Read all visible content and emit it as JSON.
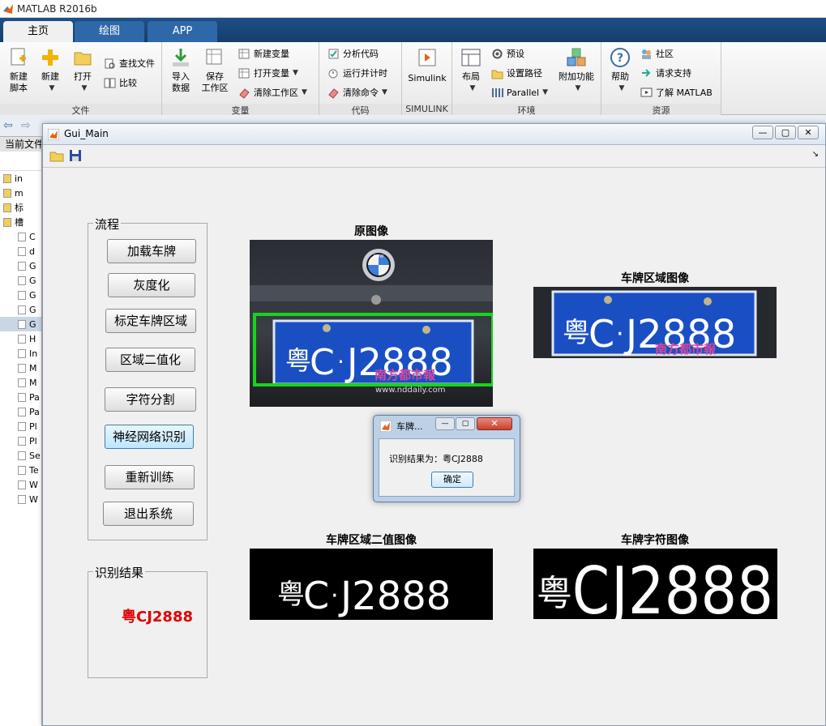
{
  "app": {
    "title": "MATLAB R2016b"
  },
  "tabs": [
    "主页",
    "绘图",
    "APP"
  ],
  "ribbon": {
    "file": {
      "label": "文件",
      "new_script": "新建\n脚本",
      "new": "新建",
      "open": "打开",
      "find_files": "查找文件",
      "compare": "比较"
    },
    "variable": {
      "label": "变量",
      "import": "导入\n数据",
      "save_ws": "保存\n工作区",
      "new_var": "新建变量",
      "open_var": "打开变量",
      "clear_ws": "清除工作区"
    },
    "code": {
      "label": "代码",
      "analyze": "分析代码",
      "run_time": "运行并计时",
      "clear_cmd": "清除命令"
    },
    "simulink": {
      "label": "SIMULINK",
      "btn": "Simulink"
    },
    "env": {
      "label": "环境",
      "layout": "布局",
      "prefs": "预设",
      "set_path": "设置路径",
      "parallel": "Parallel",
      "addons": "附加功能"
    },
    "resources": {
      "label": "资源",
      "help": "帮助",
      "community": "社区",
      "support": "请求支持",
      "learn": "了解 MATLAB"
    }
  },
  "left_pane": {
    "title": "当前文件",
    "rows": [
      "in",
      "m",
      "标",
      "槽",
      "C",
      "d",
      "G",
      "G",
      "G",
      "G",
      "G",
      "H",
      "In",
      "M",
      "M",
      "Pa",
      "Pa",
      "Pl",
      "Pl",
      "Se",
      "Te",
      "W",
      "W"
    ]
  },
  "figure": {
    "title": "Gui_Main",
    "process_panel": {
      "label": "流程",
      "buttons": [
        "加载车牌",
        "灰度化",
        "标定车牌区域",
        "区域二值化",
        "字符分割",
        "神经网络识别",
        "重新训练",
        "退出系统"
      ]
    },
    "result_panel": {
      "label": "识别结果",
      "value": "粤CJ2888"
    },
    "axes_titles": {
      "original": "原图像",
      "plate_region": "车牌区域图像",
      "binary": "车牌区域二值图像",
      "chars": "车牌字符图像"
    },
    "plate_text": {
      "province": "粤",
      "letter": "C",
      "dot": "·",
      "number": "J2888",
      "brand": "BMW",
      "watermark": "南方都市報",
      "url": "www.nddaily.com"
    }
  },
  "dialog": {
    "title": "车牌...",
    "message": "识别结果为：粤CJ2888",
    "ok": "确定"
  },
  "colors": {
    "tab_blue": "#1d4f86",
    "plate_blue": "#1a4fc4",
    "result_red": "#e00000",
    "detect_green": "#16d41e"
  }
}
